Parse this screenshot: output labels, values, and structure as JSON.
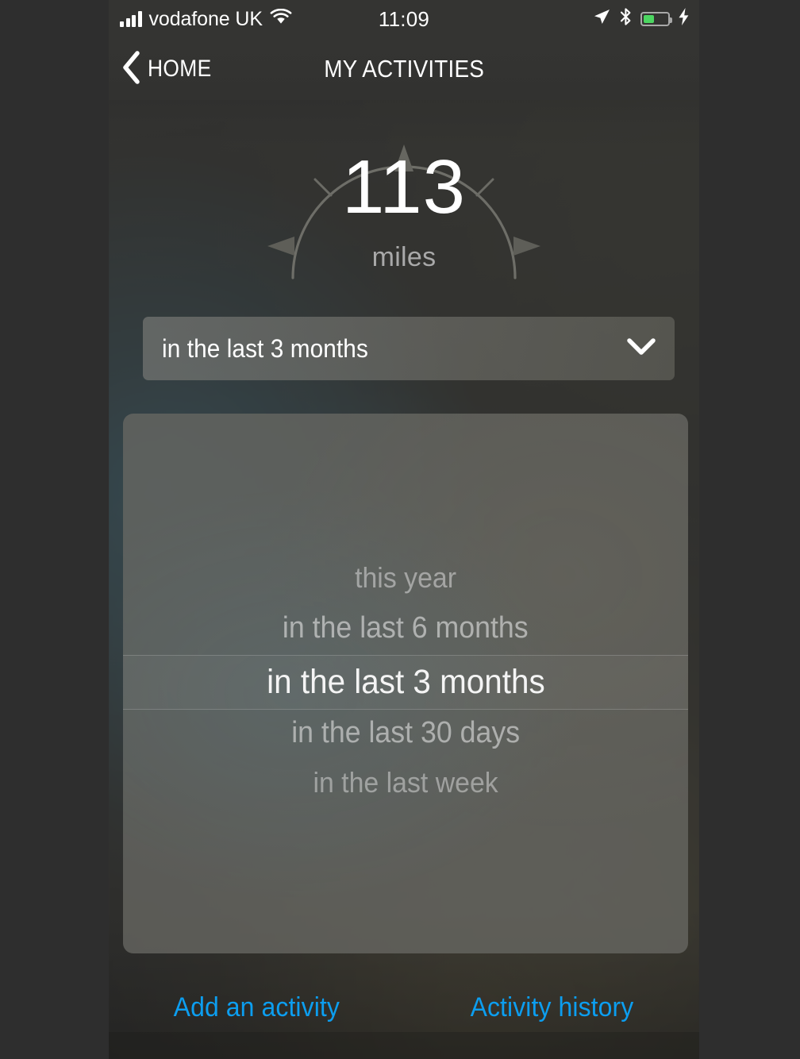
{
  "status_bar": {
    "carrier": "vodafone UK",
    "time": "11:09",
    "signal_icon": "signal-bars-icon",
    "wifi_icon": "wifi-icon",
    "location_icon": "location-arrow-icon",
    "bluetooth_icon": "bluetooth-icon",
    "battery_icon": "battery-icon",
    "battery_level_percent": 40,
    "charging_icon": "lightning-bolt-icon",
    "battery_color": "#4cd661"
  },
  "nav_bar": {
    "back_label": "HOME",
    "back_icon": "chevron-left-icon",
    "title": "MY ACTIVITIES"
  },
  "gauge": {
    "value": "113",
    "unit": "miles",
    "arc_color": "#6e6e68",
    "marker_icons": [
      "triangle-up-marker-icon",
      "triangle-left-marker-icon",
      "triangle-right-marker-icon",
      "tick-mark-icon",
      "tick-mark-icon"
    ]
  },
  "select_field": {
    "value": "in the last 3 months",
    "chevron_icon": "chevron-down-icon"
  },
  "picker": {
    "selected_index": 2,
    "options": [
      "this year",
      "in the last 6 months",
      "in the last 3 months",
      "in the last 30 days",
      "in the last week"
    ]
  },
  "bottom_links": {
    "add_activity": "Add an activity",
    "activity_history": "Activity history",
    "link_color": "#0c9ef0"
  }
}
